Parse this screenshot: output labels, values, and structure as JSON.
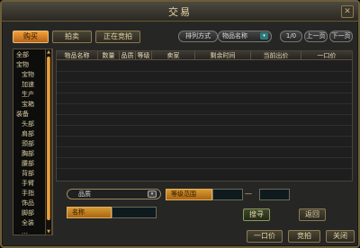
{
  "window": {
    "title": "交易",
    "close_label": "✕"
  },
  "tabs": [
    {
      "label": "购买"
    },
    {
      "label": "拍卖"
    },
    {
      "label": "正在竞拍"
    }
  ],
  "sort": {
    "label": "排列方式",
    "value": "物品名称"
  },
  "pager": {
    "page": "1/0",
    "prev": "上一页",
    "next": "下一页"
  },
  "categories": [
    "全部",
    "宝物",
    "宝物",
    "加速",
    "生产",
    "宝箱",
    "装备",
    "头部",
    "肩部",
    "颈部",
    "胸部",
    "腰部",
    "背部",
    "手臂",
    "手指",
    "饰品",
    "脚部",
    "全装",
    "…"
  ],
  "table": {
    "headers": [
      "物品名称",
      "数量",
      "品质",
      "等级",
      "卖家",
      "剩余时间",
      "当前出价",
      "一口价"
    ]
  },
  "filters": {
    "quality_label": "品质",
    "level_label": "等级范围",
    "level_dash": "—",
    "name_label": "名称"
  },
  "actions": {
    "search": "搜寻",
    "back": "返回",
    "buyout": "一口价",
    "bid": "竞拍",
    "close": "关闭"
  }
}
